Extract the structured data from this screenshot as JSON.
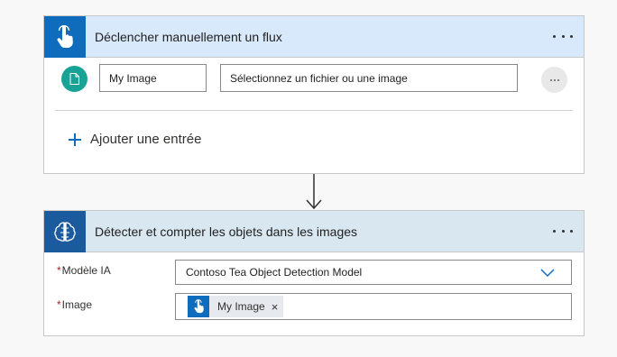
{
  "trigger": {
    "title": "Déclencher manuellement un flux",
    "icon": "touch-hand-icon",
    "input": {
      "icon": "document-icon",
      "name_value": "My Image",
      "description_value": "Sélectionnez un fichier ou une image"
    },
    "add_input_label": "Ajouter une entrée"
  },
  "action": {
    "title": "Détecter et compter les objets dans les images",
    "icon": "ai-brain-icon",
    "fields": {
      "model_label": "Modèle IA",
      "model_value": "Contoso Tea Object Detection Model",
      "image_label": "Image",
      "image_token": "My Image",
      "image_token_remove": "×"
    },
    "required_marker": "*"
  },
  "colors": {
    "accent": "#0f6cbd",
    "trigger_header_bg": "#d8e9fb",
    "action_header_bg": "#d9e7f1",
    "doc_badge": "#19a397",
    "required": "#a4262c"
  }
}
